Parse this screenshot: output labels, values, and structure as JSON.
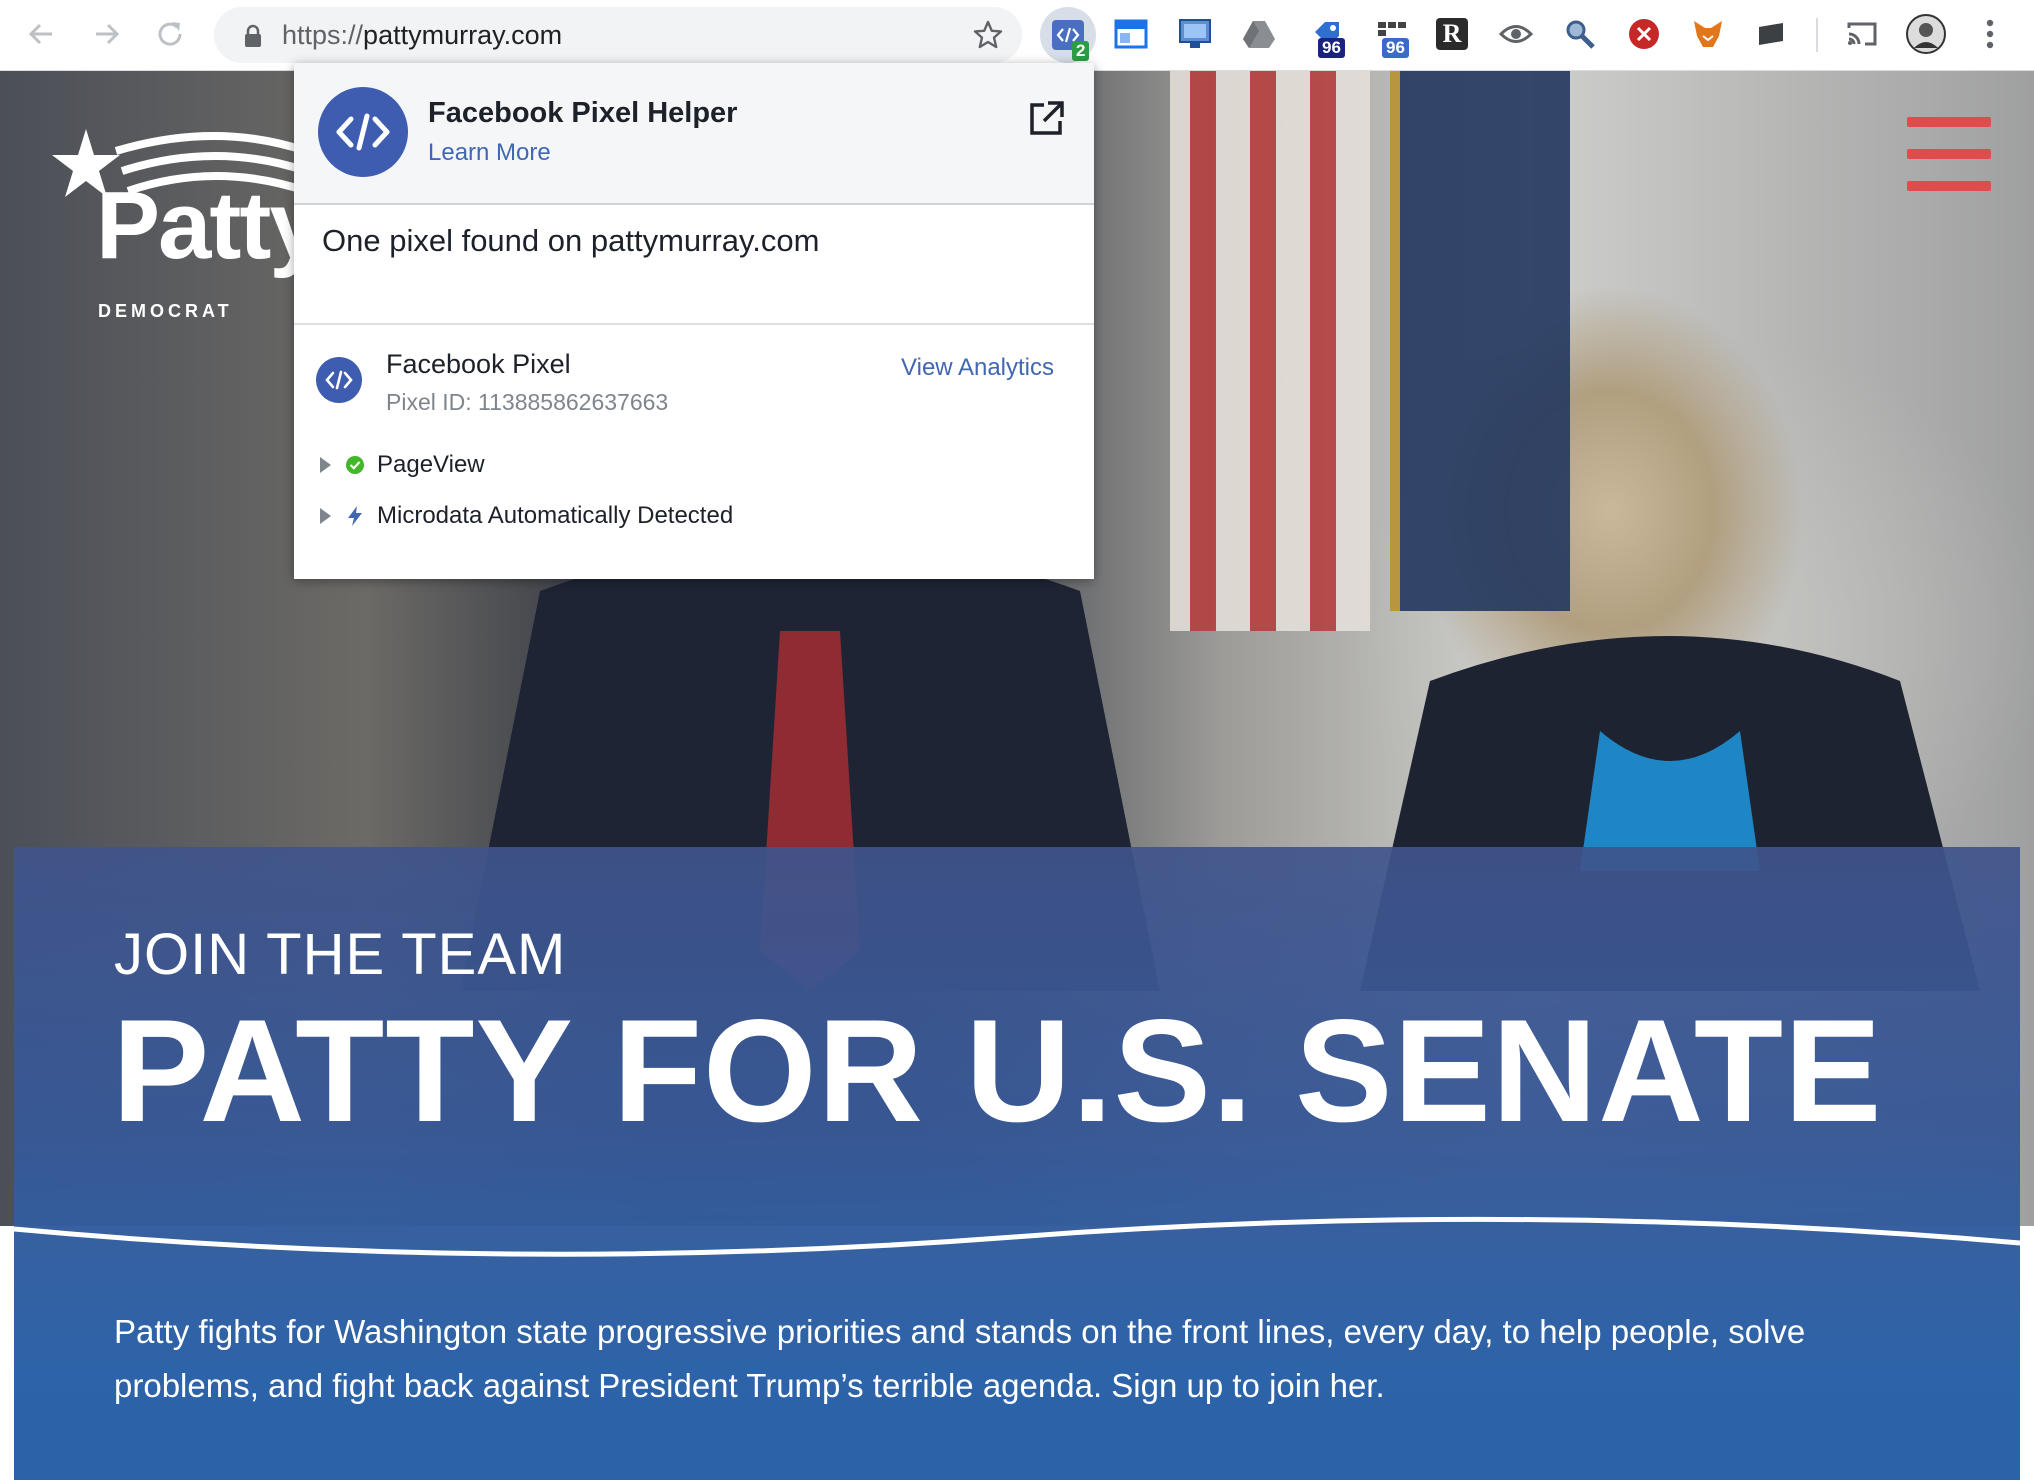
{
  "browser": {
    "url_scheme": "https://",
    "url_host": "pattymurray.com",
    "extensions": [
      {
        "name": "facebook-pixel-helper",
        "badge": "2",
        "badge_color": "#2e9c46"
      },
      {
        "name": "window-resizer",
        "badge": ""
      },
      {
        "name": "screenshot",
        "badge": ""
      },
      {
        "name": "google-drive",
        "badge": ""
      },
      {
        "name": "tag-assistant",
        "badge": "96",
        "badge_color": "#1a237e"
      },
      {
        "name": "wappalyzer",
        "badge": "96",
        "badge_color": "#3b6bc7"
      },
      {
        "name": "readability",
        "badge": ""
      },
      {
        "name": "eye",
        "badge": ""
      },
      {
        "name": "search-tool",
        "badge": ""
      },
      {
        "name": "blocker",
        "badge": ""
      },
      {
        "name": "metamask",
        "badge": ""
      },
      {
        "name": "save",
        "badge": ""
      }
    ]
  },
  "popup": {
    "title": "Facebook Pixel Helper",
    "learn_more": "Learn More",
    "summary": "One pixel found on pattymurray.com",
    "pixel": {
      "name": "Facebook Pixel",
      "id_label": "Pixel ID: 113885862637663",
      "view_analytics": "View Analytics"
    },
    "events": [
      {
        "label": "PageView",
        "icon": "check-circle-icon",
        "color": "#42b72a"
      },
      {
        "label": "Microdata Automatically Detected",
        "icon": "lightning-icon",
        "color": "#4267b2"
      }
    ],
    "brand_color": "#3e5db0"
  },
  "site": {
    "logo_name": "Patty",
    "logo_party": "DEMOCRAT",
    "kicker": "JOIN THE TEAM",
    "headline": "PATTY FOR U.S. SENATE",
    "body": "Patty fights for Washington state progressive priorities and stands on the front lines, every day, to help people, solve problems, and fight back against President Trump’s terrible agenda. Sign up to join her.",
    "accent_color": "#e24b4b"
  }
}
